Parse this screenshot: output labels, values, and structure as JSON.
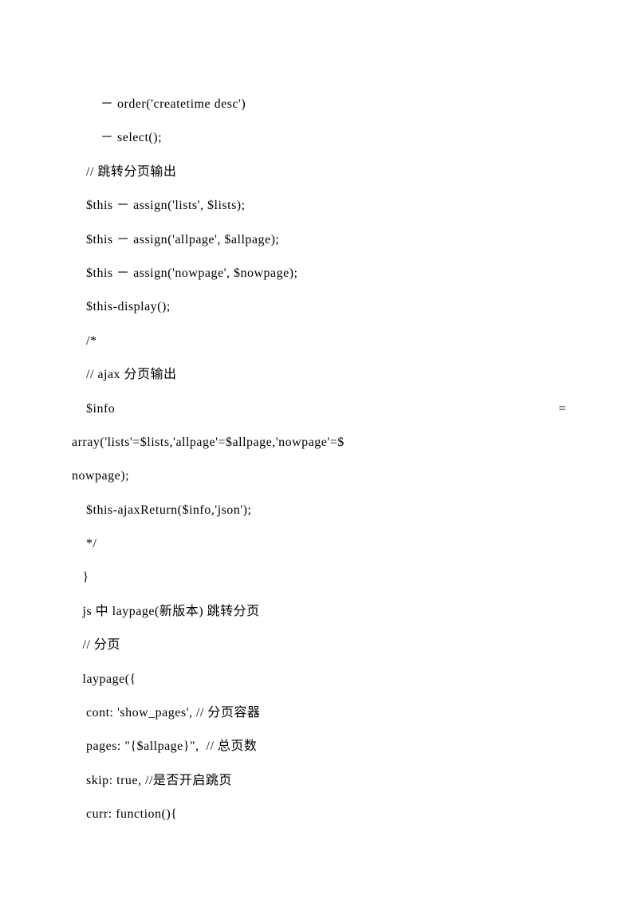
{
  "lines": [
    "        － order('createtime desc')",
    "        － select();",
    "    // 跳转分页输出",
    "    $this － assign('lists', $lists);",
    "    $this － assign('allpage', $allpage);",
    "    $this － assign('nowpage', $nowpage);",
    "    $this-display();",
    "    /*",
    "    // ajax 分页输出",
    "",
    "array('lists'=$lists,'allpage'=$allpage,'nowpage'=$",
    "nowpage);",
    "    $this-ajaxReturn($info,'json');",
    "    */",
    "   }",
    "   js 中 laypage(新版本) 跳转分页",
    "   // 分页",
    "   laypage({",
    "    cont: 'show_pages', // 分页容器",
    "    pages: \"{$allpage}\",  // 总页数",
    "    skip: true, //是否开启跳页",
    "    curr: function(){"
  ],
  "info_line_left": "    $info",
  "info_line_right": "="
}
